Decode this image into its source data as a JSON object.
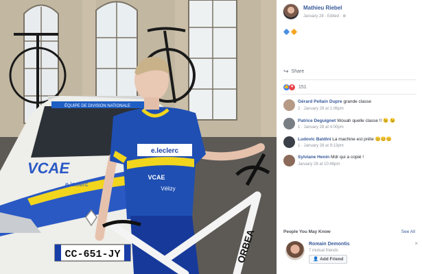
{
  "post": {
    "author": "Mathieu Riebel",
    "meta": "January 28 · Edited · ⊛",
    "share_label": "Share",
    "reactions_count": "151"
  },
  "comments": [
    {
      "name": "Gérard Pellain Dupre",
      "text": " grande classe",
      "meta": "2 · January 28 at 1:06pm",
      "avatar_color": "#b79a86"
    },
    {
      "name": "Patrice Deguignet",
      "text": " Wouah quelle classe !! 😉 😉",
      "meta": "1 · January 28 at 4:00pm",
      "avatar_color": "#7a7f86"
    },
    {
      "name": "Ludovic Baldini",
      "text": " La machine est prête 😊😊😊",
      "meta": "1 · January 28 at 9:13pm",
      "avatar_color": "#3b3f47"
    },
    {
      "name": "Sylviane Henin",
      "text": " Mdr qui a copié !",
      "meta": "January 28 at 10:46pm",
      "avatar_color": "#8c6a5a"
    }
  ],
  "pymk": {
    "title": "People You May Know",
    "see_all": "See All",
    "person_name": "Romain Demontis",
    "mutual": "7 mutual friends",
    "add_friend": "Add Friend"
  },
  "photo": {
    "plate": "CC-651-JY",
    "car_brand": "VCAE",
    "car_sponsor": "e.leclerc",
    "banner": "ÉQUIPE DE DIVISION NATIONALE",
    "jersey_sponsor": "e.leclerc",
    "jersey_team": "VCAE",
    "jersey_sub": "Vélizy",
    "frame_brand": "ORBEA"
  },
  "colors": {
    "link_blue": "#365899",
    "jersey_blue": "#1f4fb3",
    "jersey_yellow": "#f3d21a",
    "car_white": "#f2f2ee"
  }
}
